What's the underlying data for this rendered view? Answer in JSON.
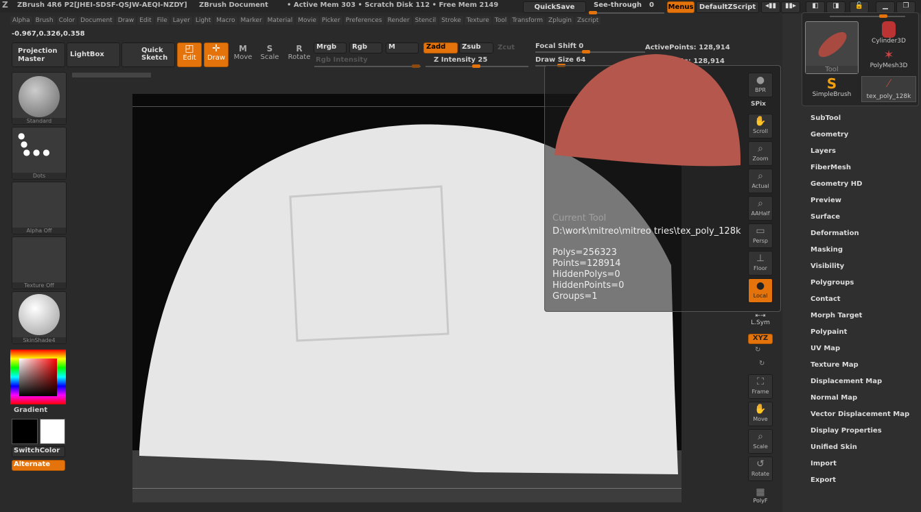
{
  "title_bar": {
    "app": "ZBrush 4R6 P2[JHEI-SDSF-QSJW-AEQI-NZDY]",
    "document": "ZBrush Document",
    "status": "• Active Mem 303 • Scratch Disk 112 • Free Mem 2149",
    "quicksave": "QuickSave",
    "see_through": "See-through",
    "see_through_value": "0",
    "menus": "Menus",
    "zscript": "DefaultZScript"
  },
  "menu": [
    "Alpha",
    "Brush",
    "Color",
    "Document",
    "Draw",
    "Edit",
    "File",
    "Layer",
    "Light",
    "Macro",
    "Marker",
    "Material",
    "Movie",
    "Picker",
    "Preferences",
    "Render",
    "Stencil",
    "Stroke",
    "Texture",
    "Tool",
    "Transform",
    "Zplugin",
    "Zscript"
  ],
  "coords": "-0.967,0.326,0.358",
  "toolbar": {
    "projection_master": "Projection Master",
    "lightbox": "LightBox",
    "quick_sketch": "Quick Sketch",
    "edit": "Edit",
    "draw": "Draw",
    "move": "Move",
    "scale": "Scale",
    "rotate": "Rotate",
    "mrgb": "Mrgb",
    "rgb": "Rgb",
    "m": "M",
    "rgb_intensity": "Rgb Intensity",
    "zadd": "Zadd",
    "zsub": "Zsub",
    "zcut": "Zcut",
    "z_intensity": "Z Intensity 25",
    "focal_shift": "Focal Shift 0",
    "draw_size": "Draw Size 64",
    "active_points": "ActivePoints: 128,914",
    "total_points": "TotalPoints: 128,914",
    "z_intensity_value": 25,
    "focal_shift_value": 0,
    "draw_size_value": 64
  },
  "left_shelf": {
    "brush": "Standard",
    "stroke": "Dots",
    "alpha": "Alpha Off",
    "texture": "Texture Off",
    "material": "SkinShade4",
    "gradient": "Gradient",
    "switch_color": "SwitchColor",
    "alternate": "Alternate"
  },
  "tooltip": {
    "heading": "Current Tool",
    "path": "D:\\work\\mitreo\\mitreo tries\\tex_poly_128k",
    "lines": [
      "Polys=256323",
      "Points=128914",
      "HiddenPolys=0",
      "HiddenPoints=0",
      "Groups=1"
    ]
  },
  "right_tools": [
    "BPR",
    "SPix",
    "Scroll",
    "Zoom",
    "Actual",
    "AAHalf",
    "Persp",
    "Floor",
    "Local",
    "L.Sym",
    "XYZ",
    "Frame",
    "Move",
    "Scale",
    "Rotate",
    "PolyF"
  ],
  "tool_palette": {
    "current": "Tool",
    "items": [
      "Cylinder3D",
      "PolyMesh3D",
      "SimpleBrush",
      "tex_poly_128k"
    ]
  },
  "tool_menu": [
    "SubTool",
    "Geometry",
    "Layers",
    "FiberMesh",
    "Geometry HD",
    "Preview",
    "Surface",
    "Deformation",
    "Masking",
    "Visibility",
    "Polygroups",
    "Contact",
    "Morph Target",
    "Polypaint",
    "UV Map",
    "Texture Map",
    "Displacement Map",
    "Normal Map",
    "Vector Displacement Map",
    "Display Properties",
    "Unified Skin",
    "Import",
    "Export"
  ],
  "colors": {
    "accent": "#e5730b",
    "mesh": "#b5574c"
  }
}
